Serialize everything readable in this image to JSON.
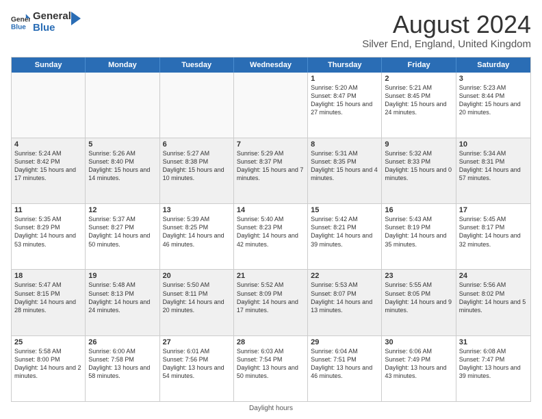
{
  "header": {
    "logo_general": "General",
    "logo_blue": "Blue",
    "month_year": "August 2024",
    "location": "Silver End, England, United Kingdom"
  },
  "days_of_week": [
    "Sunday",
    "Monday",
    "Tuesday",
    "Wednesday",
    "Thursday",
    "Friday",
    "Saturday"
  ],
  "rows": [
    [
      {
        "day": "",
        "empty": true
      },
      {
        "day": "",
        "empty": true
      },
      {
        "day": "",
        "empty": true
      },
      {
        "day": "",
        "empty": true
      },
      {
        "day": "1",
        "sunrise": "5:20 AM",
        "sunset": "8:47 PM",
        "daylight": "15 hours and 27 minutes."
      },
      {
        "day": "2",
        "sunrise": "5:21 AM",
        "sunset": "8:45 PM",
        "daylight": "15 hours and 24 minutes."
      },
      {
        "day": "3",
        "sunrise": "5:23 AM",
        "sunset": "8:44 PM",
        "daylight": "15 hours and 20 minutes."
      }
    ],
    [
      {
        "day": "4",
        "sunrise": "5:24 AM",
        "sunset": "8:42 PM",
        "daylight": "15 hours and 17 minutes."
      },
      {
        "day": "5",
        "sunrise": "5:26 AM",
        "sunset": "8:40 PM",
        "daylight": "15 hours and 14 minutes."
      },
      {
        "day": "6",
        "sunrise": "5:27 AM",
        "sunset": "8:38 PM",
        "daylight": "15 hours and 10 minutes."
      },
      {
        "day": "7",
        "sunrise": "5:29 AM",
        "sunset": "8:37 PM",
        "daylight": "15 hours and 7 minutes."
      },
      {
        "day": "8",
        "sunrise": "5:31 AM",
        "sunset": "8:35 PM",
        "daylight": "15 hours and 4 minutes."
      },
      {
        "day": "9",
        "sunrise": "5:32 AM",
        "sunset": "8:33 PM",
        "daylight": "15 hours and 0 minutes."
      },
      {
        "day": "10",
        "sunrise": "5:34 AM",
        "sunset": "8:31 PM",
        "daylight": "14 hours and 57 minutes."
      }
    ],
    [
      {
        "day": "11",
        "sunrise": "5:35 AM",
        "sunset": "8:29 PM",
        "daylight": "14 hours and 53 minutes."
      },
      {
        "day": "12",
        "sunrise": "5:37 AM",
        "sunset": "8:27 PM",
        "daylight": "14 hours and 50 minutes."
      },
      {
        "day": "13",
        "sunrise": "5:39 AM",
        "sunset": "8:25 PM",
        "daylight": "14 hours and 46 minutes."
      },
      {
        "day": "14",
        "sunrise": "5:40 AM",
        "sunset": "8:23 PM",
        "daylight": "14 hours and 42 minutes."
      },
      {
        "day": "15",
        "sunrise": "5:42 AM",
        "sunset": "8:21 PM",
        "daylight": "14 hours and 39 minutes."
      },
      {
        "day": "16",
        "sunrise": "5:43 AM",
        "sunset": "8:19 PM",
        "daylight": "14 hours and 35 minutes."
      },
      {
        "day": "17",
        "sunrise": "5:45 AM",
        "sunset": "8:17 PM",
        "daylight": "14 hours and 32 minutes."
      }
    ],
    [
      {
        "day": "18",
        "sunrise": "5:47 AM",
        "sunset": "8:15 PM",
        "daylight": "14 hours and 28 minutes."
      },
      {
        "day": "19",
        "sunrise": "5:48 AM",
        "sunset": "8:13 PM",
        "daylight": "14 hours and 24 minutes."
      },
      {
        "day": "20",
        "sunrise": "5:50 AM",
        "sunset": "8:11 PM",
        "daylight": "14 hours and 20 minutes."
      },
      {
        "day": "21",
        "sunrise": "5:52 AM",
        "sunset": "8:09 PM",
        "daylight": "14 hours and 17 minutes."
      },
      {
        "day": "22",
        "sunrise": "5:53 AM",
        "sunset": "8:07 PM",
        "daylight": "14 hours and 13 minutes."
      },
      {
        "day": "23",
        "sunrise": "5:55 AM",
        "sunset": "8:05 PM",
        "daylight": "14 hours and 9 minutes."
      },
      {
        "day": "24",
        "sunrise": "5:56 AM",
        "sunset": "8:02 PM",
        "daylight": "14 hours and 5 minutes."
      }
    ],
    [
      {
        "day": "25",
        "sunrise": "5:58 AM",
        "sunset": "8:00 PM",
        "daylight": "14 hours and 2 minutes."
      },
      {
        "day": "26",
        "sunrise": "6:00 AM",
        "sunset": "7:58 PM",
        "daylight": "13 hours and 58 minutes."
      },
      {
        "day": "27",
        "sunrise": "6:01 AM",
        "sunset": "7:56 PM",
        "daylight": "13 hours and 54 minutes."
      },
      {
        "day": "28",
        "sunrise": "6:03 AM",
        "sunset": "7:54 PM",
        "daylight": "13 hours and 50 minutes."
      },
      {
        "day": "29",
        "sunrise": "6:04 AM",
        "sunset": "7:51 PM",
        "daylight": "13 hours and 46 minutes."
      },
      {
        "day": "30",
        "sunrise": "6:06 AM",
        "sunset": "7:49 PM",
        "daylight": "13 hours and 43 minutes."
      },
      {
        "day": "31",
        "sunrise": "6:08 AM",
        "sunset": "7:47 PM",
        "daylight": "13 hours and 39 minutes."
      }
    ]
  ],
  "footer": "Daylight hours"
}
